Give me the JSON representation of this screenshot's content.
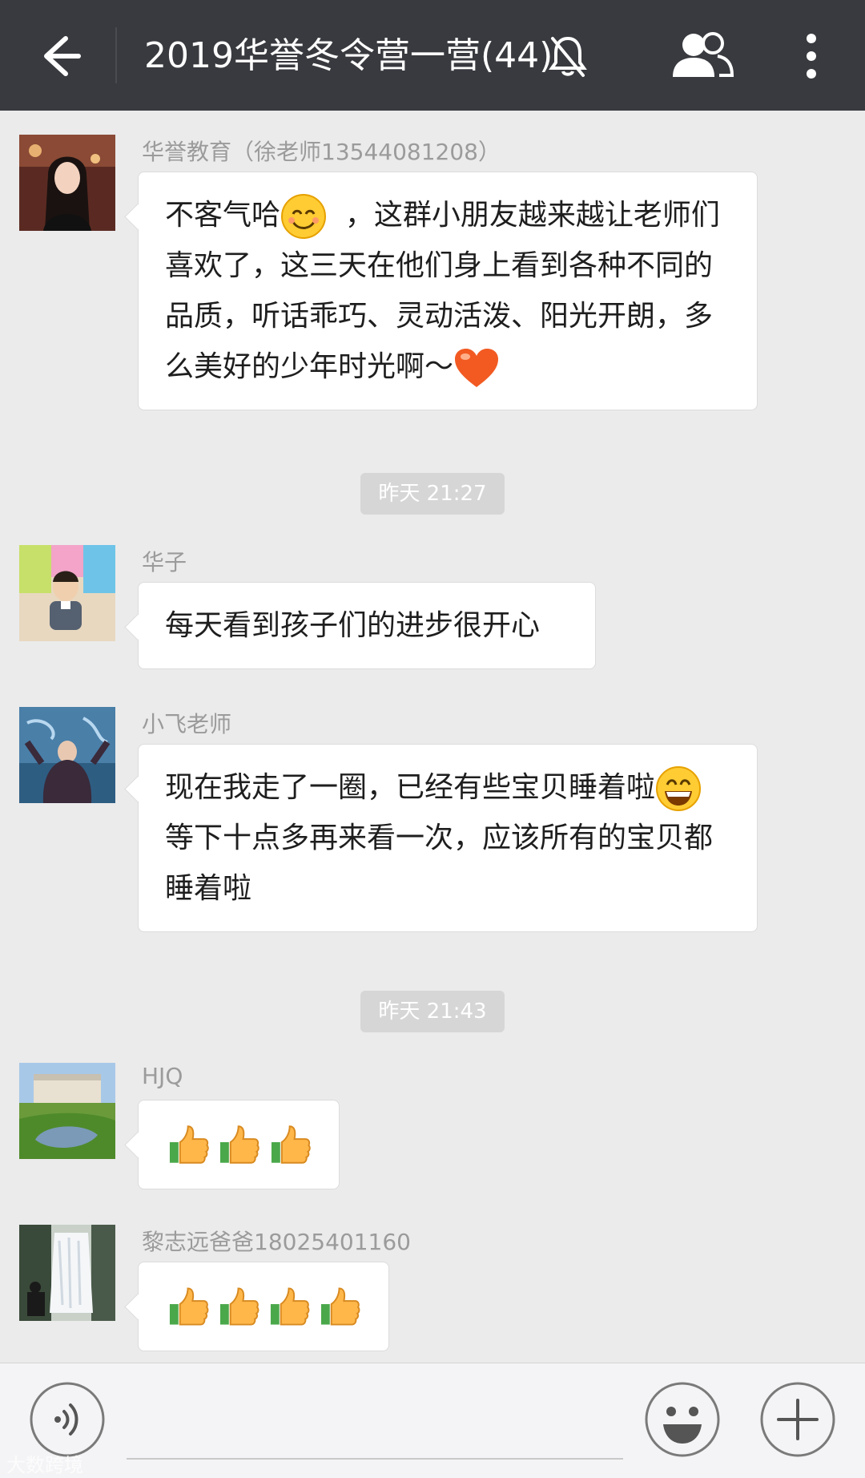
{
  "header": {
    "title": "2019华誉冬令营一营(44)",
    "back_icon": "arrow-left-icon",
    "mute_icon": "bell-off-icon",
    "members_icon": "group-icon",
    "more_icon": "more-vertical-icon",
    "background": "#393a3f"
  },
  "messages": [
    {
      "sender": "华誉教育（徐老师13544081208）",
      "text_parts": [
        "不客气哈",
        "，这群小朋友越来越让老师们喜欢了，这三天在他们身上看到各种不同的品质，听话乖巧、灵动活泼、阳光开朗，多么美好的少年时光啊～"
      ],
      "emojis": [
        "smile-emoji",
        "heart-emoji"
      ]
    },
    {
      "time": "昨天 21:27"
    },
    {
      "sender": "华子",
      "text": "每天看到孩子们的进步很开心"
    },
    {
      "sender": "小飞老师",
      "text_parts": [
        "现在我走了一圈，已经有些宝贝睡着啦",
        "等下十点多再来看一次，应该所有的宝贝都睡着啦"
      ],
      "emojis": [
        "grin-emoji"
      ]
    },
    {
      "time": "昨天 21:43"
    },
    {
      "sender": "HJQ",
      "emojis": [
        "thumbs-up-emoji",
        "thumbs-up-emoji",
        "thumbs-up-emoji"
      ]
    },
    {
      "sender": "黎志远爸爸18025401160",
      "emojis": [
        "thumbs-up-emoji",
        "thumbs-up-emoji",
        "thumbs-up-emoji",
        "thumbs-up-emoji"
      ]
    }
  ],
  "footer": {
    "voice_icon": "voice-icon",
    "emoji_icon": "emoji-icon",
    "plus_icon": "plus-icon",
    "input_value": ""
  },
  "watermark": "大数跨境"
}
